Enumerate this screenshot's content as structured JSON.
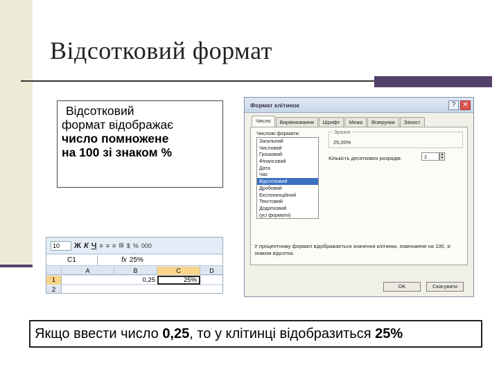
{
  "title": "Відсотковий формат",
  "definition": {
    "line1": "Відсотковий",
    "line2": "формат відображає",
    "line3": "число помножене",
    "line4": "на 100 зі знаком %"
  },
  "excel": {
    "font_size": "10",
    "toolbar_buttons": [
      "Ж",
      "К",
      "Ч"
    ],
    "toolbar_icons": [
      "Ξ",
      "≡",
      "≡",
      "⊞",
      "%",
      "000",
      "",
      ",0"
    ],
    "name_box": "C1",
    "fx": "fx",
    "formula_value": "25%",
    "columns": [
      "A",
      "B",
      "C",
      "D"
    ],
    "rows": [
      {
        "header": "1",
        "b": "0,25",
        "c": "25%"
      },
      {
        "header": "2",
        "b": "",
        "c": ""
      }
    ]
  },
  "dialog": {
    "title": "Формат клітинок",
    "tabs": [
      "Число",
      "Вирівнювання",
      "Шрифт",
      "Межа",
      "Візерунки",
      "Захист"
    ],
    "active_tab": "Число",
    "category_label": "Числові формати:",
    "categories": [
      "Загальний",
      "Числовий",
      "Грошовий",
      "Фінансовий",
      "Дата",
      "Час",
      "Відсотковий",
      "Дробовий",
      "Експоненційний",
      "Текстовий",
      "Додатковий",
      "(усі формати)"
    ],
    "selected_category": "Відсотковий",
    "sample_label": "Зразок",
    "sample_value": "25,00%",
    "decimals_label": "Кількість десяткових розрядів:",
    "decimals_value": "2",
    "description": "У процентному форматі відображається значення клітинки, помножене на 100, зі знаком відсотка.",
    "ok_label": "OK",
    "cancel_label": "Скасувати",
    "help_label": "?",
    "close_label": "✕"
  },
  "bottom": {
    "pre": "Якщо ввести число ",
    "num": "0,25",
    "mid": ", то у клітинці відобразиться ",
    "pct": "25%"
  }
}
